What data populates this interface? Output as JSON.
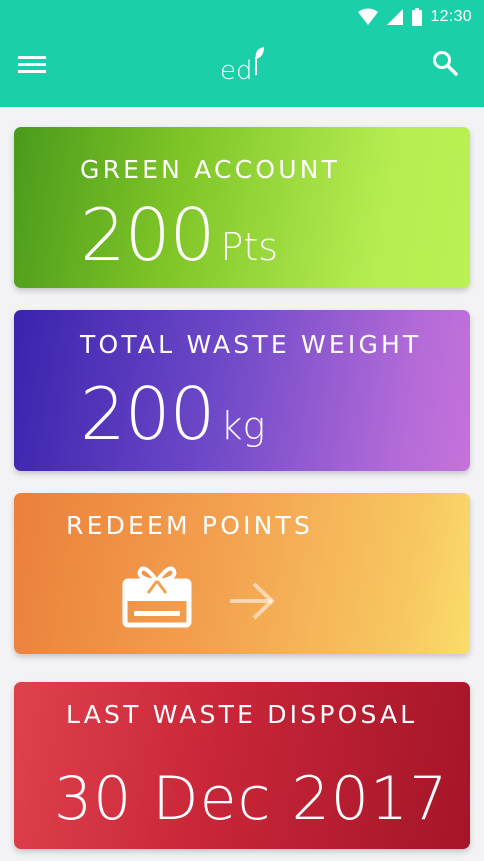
{
  "status_bar": {
    "time": "12:30",
    "icons": [
      "wifi-icon",
      "signal-icon",
      "battery-icon"
    ]
  },
  "app_bar": {
    "logo_text": "ed",
    "menu_icon": "hamburger-menu-icon",
    "search_icon": "search-icon",
    "color": "#1bd0a8"
  },
  "cards": {
    "green_account": {
      "title": "GREEN ACCOUNT",
      "value": "200",
      "unit": "Pts"
    },
    "total_waste": {
      "title": "TOTAL WASTE WEIGHT",
      "value": "200",
      "unit": "kg"
    },
    "redeem": {
      "title": "REDEEM POINTS",
      "icon": "gift-card-icon",
      "arrow": "arrow-right-icon"
    },
    "last_disposal": {
      "title": "LAST WASTE DISPOSAL",
      "date": "30 Dec 2017"
    }
  }
}
